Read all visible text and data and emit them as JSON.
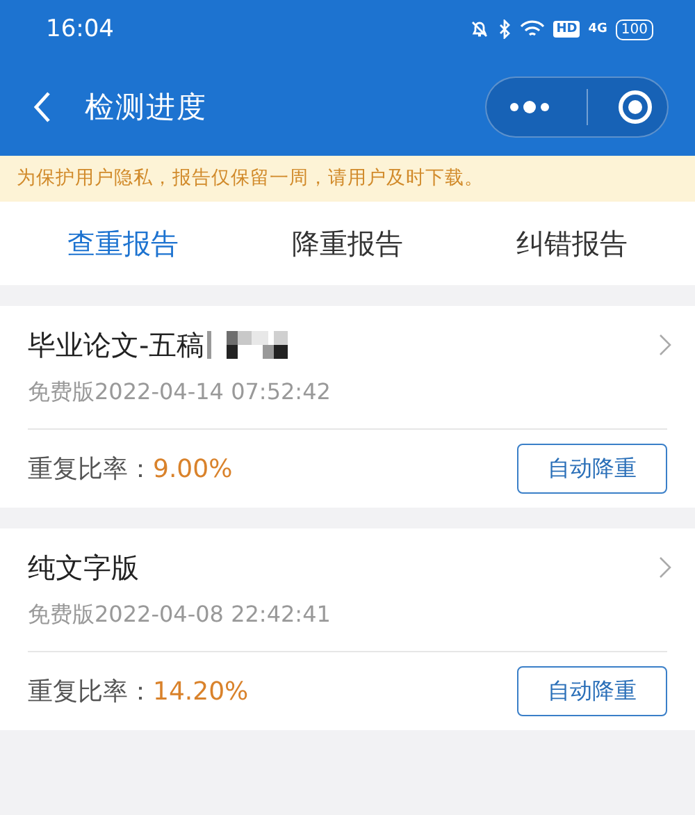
{
  "status_bar": {
    "time": "16:04",
    "hd": "HD",
    "network": "4G",
    "battery": "100"
  },
  "nav": {
    "title": "检测进度"
  },
  "notice": "为保护用户隐私，报告仅保留一周，请用户及时下载。",
  "tabs": [
    {
      "label": "查重报告",
      "selected": true
    },
    {
      "label": "降重报告",
      "selected": false
    },
    {
      "label": "纠错报告",
      "selected": false
    }
  ],
  "reports": [
    {
      "title": "毕业论文-五稿",
      "redacted": true,
      "date": "免费版2022-04-14 07:52:42",
      "rate_label": "重复比率：",
      "rate": "9.00%",
      "button": "自动降重"
    },
    {
      "title": "纯文字版",
      "redacted": false,
      "date": "免费版2022-04-08 22:42:41",
      "rate_label": "重复比率：",
      "rate": "14.20%",
      "button": "自动降重"
    }
  ]
}
